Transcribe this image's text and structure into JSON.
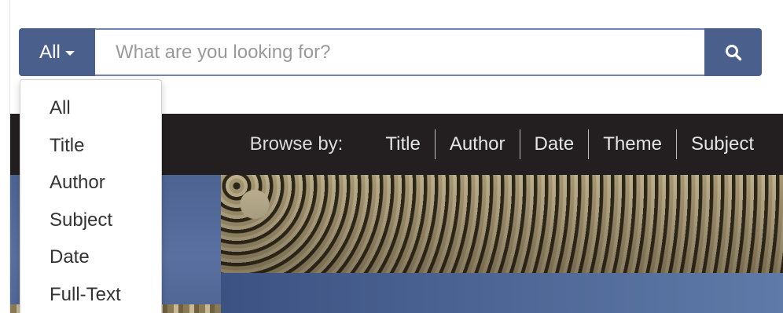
{
  "search": {
    "scope_label": "All",
    "placeholder": "What are you looking for?",
    "value": ""
  },
  "dropdown": {
    "items": [
      {
        "label": "All"
      },
      {
        "label": "Title"
      },
      {
        "label": "Author"
      },
      {
        "label": "Subject"
      },
      {
        "label": "Date"
      },
      {
        "label": "Full-Text"
      }
    ]
  },
  "browse": {
    "label": "Browse by:",
    "links": [
      {
        "label": "Title"
      },
      {
        "label": "Author"
      },
      {
        "label": "Date"
      },
      {
        "label": "Theme"
      },
      {
        "label": "Subject"
      }
    ]
  },
  "colors": {
    "accent": "#4a5f8c",
    "browse_bar": "#231f20"
  }
}
